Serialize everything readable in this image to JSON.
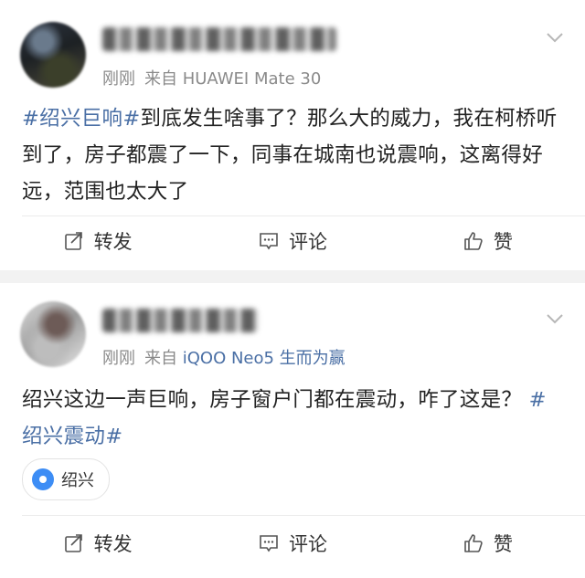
{
  "posts": [
    {
      "source_prefix": "刚刚",
      "source_via": "来自 HUAWEI Mate 30",
      "body_tag": "#绍兴巨响#",
      "body_text": "到底发生啥事了？那么大的威力，我在柯桥听到了，房子都震了一下，同事在城南也说震响，这离得好远，范围也太大了",
      "actions": {
        "repost": "转发",
        "comment": "评论",
        "like": "赞"
      }
    },
    {
      "source_prefix": "刚刚",
      "source_from": "来自",
      "source_device": "iQOO Neo5 生而为赢",
      "body_text": "绍兴这边一声巨响，房子窗户门都在震动，咋了这是？",
      "body_tag": "#绍兴震动#",
      "location": "绍兴",
      "actions": {
        "repost": "转发",
        "comment": "评论",
        "like": "赞"
      }
    }
  ],
  "colors": {
    "link": "#4a6fa5",
    "location_pin": "#3d8df5",
    "feed_bg": "#f2f2f2"
  },
  "icons": [
    "chevron-down-icon",
    "repost-icon",
    "comment-icon",
    "like-icon",
    "location-pin-icon"
  ]
}
